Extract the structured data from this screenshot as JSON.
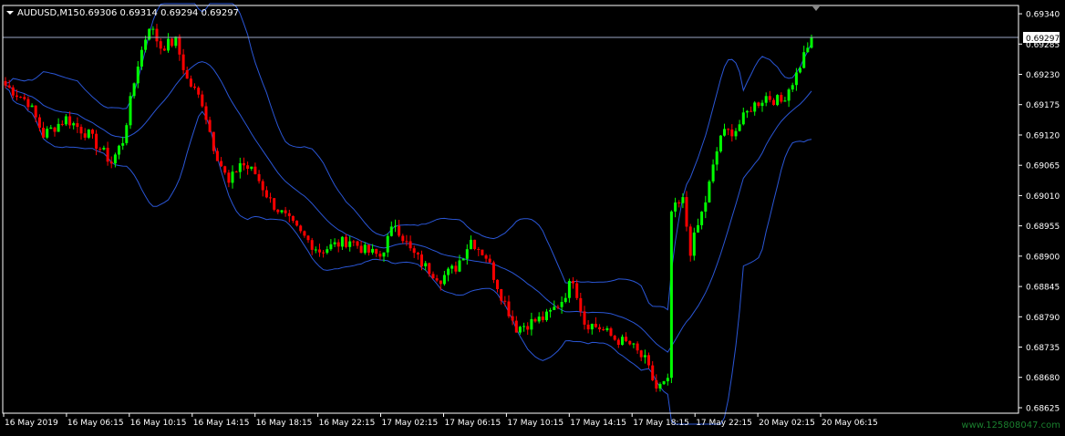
{
  "window": {
    "symbol_label": "AUDUSD,M15",
    "ohlc_label": "0.69306 0.69314 0.69294 0.69297",
    "watermark": "www.125808047.com"
  },
  "colors": {
    "background": "#000000",
    "bull_candle": "#00ff00",
    "bear_candle": "#ff0000",
    "bands": "#2a56d6",
    "price_line": "#9aa6c4",
    "axis_text": "#ffffff",
    "watermark": "#1a7f2e"
  },
  "chart_data": {
    "type": "candlestick",
    "symbol": "AUDUSD",
    "timeframe": "M15",
    "current_price": 0.69297,
    "current_price_label": "0.69297",
    "y_range": [
      0.68615,
      0.69355
    ],
    "y_ticks": [
      0.6934,
      0.69285,
      0.6923,
      0.69175,
      0.6912,
      0.69065,
      0.6901,
      0.68955,
      0.689,
      0.68845,
      0.6879,
      0.68735,
      0.6868,
      0.68625
    ],
    "y_tick_labels": [
      "0.69340",
      "0.69285",
      "0.69230",
      "0.69175",
      "0.69120",
      "0.69065",
      "0.69010",
      "0.68955",
      "0.68900",
      "0.68845",
      "0.68790",
      "0.68735",
      "0.68680",
      "0.68625"
    ],
    "x_tick_labels": [
      "16 May 2019",
      "16 May 06:15",
      "16 May 10:15",
      "16 May 14:15",
      "16 May 18:15",
      "16 May 22:15",
      "17 May 02:15",
      "17 May 06:15",
      "17 May 10:15",
      "17 May 14:15",
      "17 May 18:15",
      "17 May 22:15",
      "20 May 02:15",
      "20 May 06:15"
    ],
    "close_path": [
      [
        0,
        0.6921
      ],
      [
        6,
        0.6918
      ],
      [
        10,
        0.6912
      ],
      [
        16,
        0.6915
      ],
      [
        22,
        0.6912
      ],
      [
        28,
        0.6907
      ],
      [
        31,
        0.6911
      ],
      [
        35,
        0.6925
      ],
      [
        38,
        0.6932
      ],
      [
        41,
        0.6928
      ],
      [
        45,
        0.6929
      ],
      [
        48,
        0.6922
      ],
      [
        52,
        0.6918
      ],
      [
        55,
        0.691
      ],
      [
        59,
        0.6903
      ],
      [
        62,
        0.6907
      ],
      [
        66,
        0.6905
      ],
      [
        70,
        0.69
      ],
      [
        74,
        0.6897
      ],
      [
        78,
        0.6894
      ],
      [
        83,
        0.6891
      ],
      [
        87,
        0.6892
      ],
      [
        91,
        0.6893
      ],
      [
        95,
        0.6891
      ],
      [
        99,
        0.689
      ],
      [
        103,
        0.6896
      ],
      [
        107,
        0.6891
      ],
      [
        111,
        0.6888
      ],
      [
        115,
        0.6886
      ],
      [
        119,
        0.6888
      ],
      [
        123,
        0.6893
      ],
      [
        127,
        0.689
      ],
      [
        131,
        0.6883
      ],
      [
        135,
        0.6877
      ],
      [
        139,
        0.6878
      ],
      [
        143,
        0.6879
      ],
      [
        147,
        0.6882
      ],
      [
        150,
        0.6886
      ],
      [
        153,
        0.6878
      ],
      [
        157,
        0.6877
      ],
      [
        161,
        0.6875
      ],
      [
        165,
        0.6874
      ],
      [
        169,
        0.6871
      ],
      [
        172,
        0.6866
      ],
      [
        175,
        0.6867
      ],
      [
        176,
        0.6898
      ],
      [
        179,
        0.69
      ],
      [
        181,
        0.6891
      ],
      [
        185,
        0.69
      ],
      [
        189,
        0.6912
      ],
      [
        193,
        0.6913
      ],
      [
        197,
        0.6917
      ],
      [
        201,
        0.6919
      ],
      [
        205,
        0.6918
      ],
      [
        209,
        0.6923
      ],
      [
        213,
        0.693
      ]
    ]
  }
}
